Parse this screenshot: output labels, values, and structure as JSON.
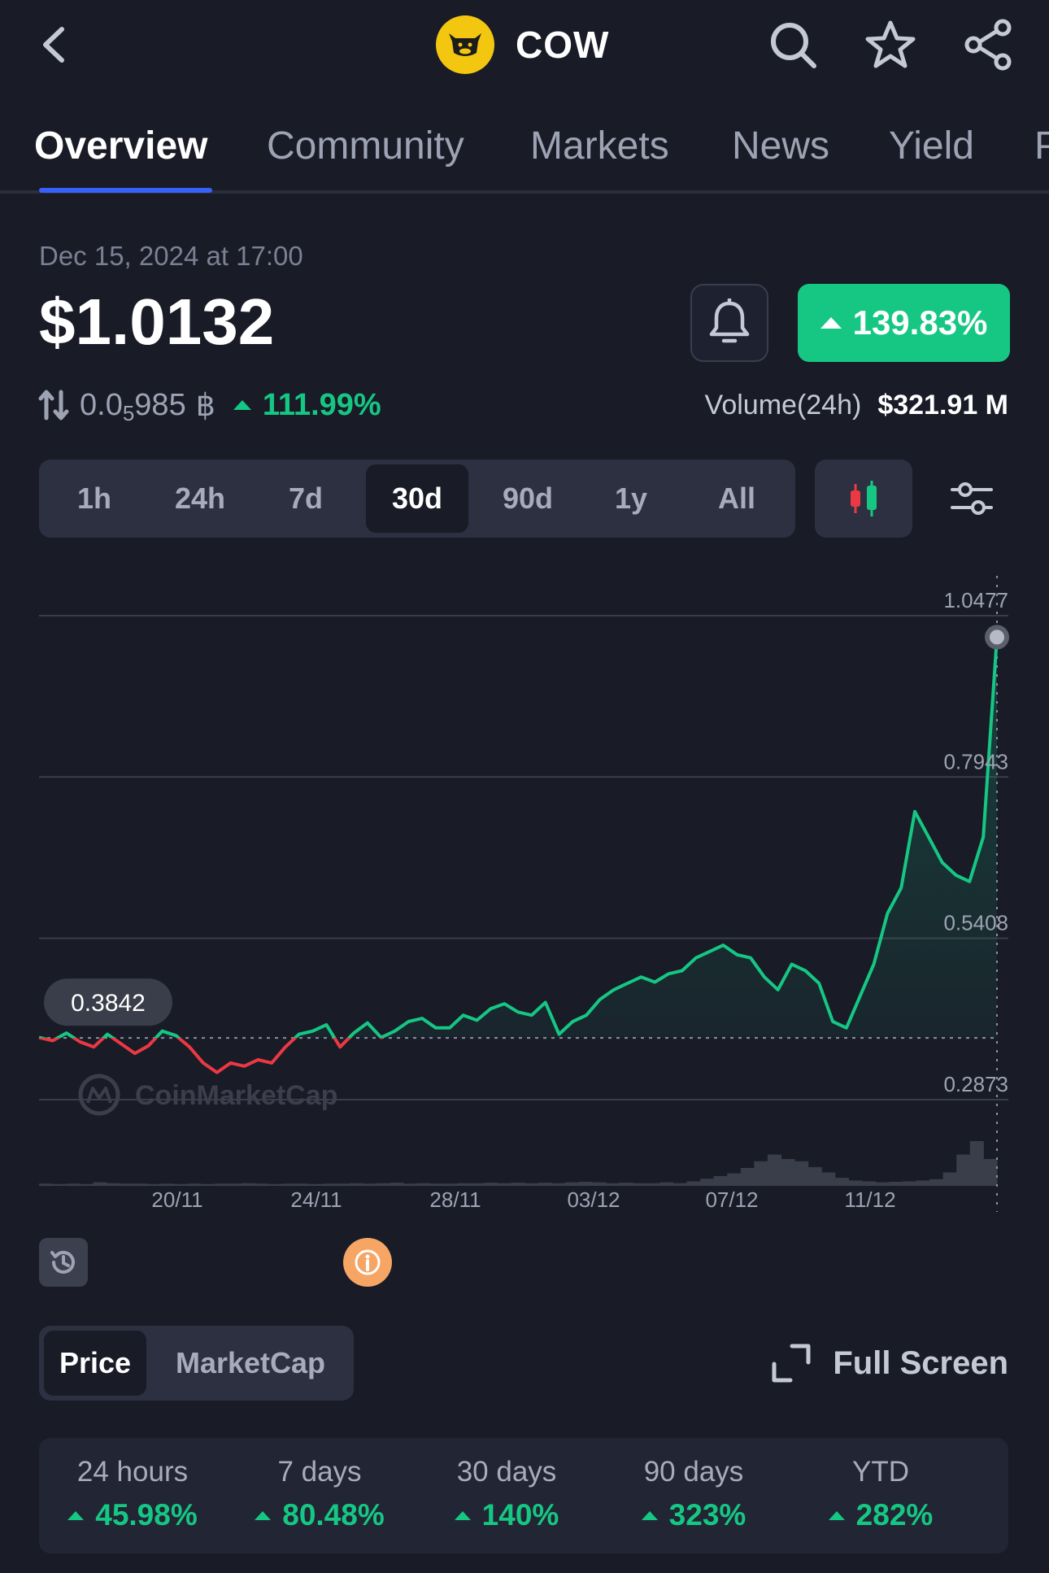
{
  "header": {
    "coin_name": "COW",
    "icons": [
      "back-chevron-icon",
      "search-icon",
      "star-icon",
      "share-icon"
    ]
  },
  "tabs": [
    {
      "label": "Overview",
      "active": true
    },
    {
      "label": "Community"
    },
    {
      "label": "Markets"
    },
    {
      "label": "News"
    },
    {
      "label": "Yield"
    },
    {
      "label": "P"
    }
  ],
  "price": {
    "timestamp": "Dec 15, 2024 at 17:00",
    "value": "$1.0132",
    "change_pct": "139.83%",
    "btc_prefix": "0.0",
    "btc_zeros": "5",
    "btc_digits": "985",
    "btc_symbol": "฿",
    "btc_change": "111.99%",
    "volume_label": "Volume(24h)",
    "volume_value": "$321.91 M"
  },
  "ranges": [
    "1h",
    "24h",
    "7d",
    "30d",
    "90d",
    "1y",
    "All"
  ],
  "active_range": "30d",
  "colors": {
    "up": "#16c784",
    "down": "#ea3943",
    "bg": "#191b27",
    "accent": "#3861fb"
  },
  "chart_data": {
    "type": "line",
    "y_ticks": [
      "1.0477",
      "0.7943",
      "0.5408",
      "0.2873"
    ],
    "ylim": [
      0.2873,
      1.0477
    ],
    "x_ticks": [
      "20/11",
      "24/11",
      "28/11",
      "03/12",
      "07/12",
      "11/12"
    ],
    "baseline_label": "0.3842",
    "baseline": 0.3842,
    "watermark": "CoinMarketCap",
    "series": [
      {
        "x": [
          0,
          1,
          2,
          3,
          4,
          5,
          6,
          7,
          8,
          9,
          10,
          11,
          12,
          13,
          14,
          15,
          16,
          17,
          18,
          19,
          20,
          21,
          22,
          23,
          24,
          25,
          26,
          27,
          28,
          29,
          30,
          31,
          32,
          33,
          34,
          35,
          36,
          37,
          38,
          39,
          40,
          41,
          42,
          43,
          44,
          45,
          46,
          47,
          48,
          49,
          50,
          51,
          52,
          53,
          54,
          55,
          56,
          57,
          58,
          59,
          60,
          61,
          62,
          63,
          64,
          65,
          66,
          67,
          68,
          69,
          70
        ],
        "y": [
          0.385,
          0.38,
          0.392,
          0.378,
          0.37,
          0.39,
          0.375,
          0.36,
          0.372,
          0.395,
          0.388,
          0.37,
          0.345,
          0.33,
          0.345,
          0.34,
          0.35,
          0.345,
          0.37,
          0.39,
          0.395,
          0.405,
          0.37,
          0.392,
          0.408,
          0.385,
          0.395,
          0.41,
          0.415,
          0.4,
          0.4,
          0.42,
          0.412,
          0.43,
          0.438,
          0.425,
          0.42,
          0.44,
          0.39,
          0.41,
          0.42,
          0.445,
          0.46,
          0.47,
          0.48,
          0.472,
          0.485,
          0.49,
          0.51,
          0.52,
          0.53,
          0.515,
          0.51,
          0.48,
          0.46,
          0.5,
          0.49,
          0.47,
          0.41,
          0.4,
          0.45,
          0.5,
          0.58,
          0.62,
          0.74,
          0.7,
          0.66,
          0.64,
          0.63,
          0.7,
          1.014
        ]
      }
    ],
    "volume_bars": [
      0.05,
      0.04,
      0.05,
      0.04,
      0.08,
      0.06,
      0.05,
      0.05,
      0.04,
      0.05,
      0.04,
      0.05,
      0.04,
      0.05,
      0.05,
      0.06,
      0.05,
      0.04,
      0.05,
      0.05,
      0.04,
      0.05,
      0.05,
      0.06,
      0.05,
      0.06,
      0.07,
      0.05,
      0.06,
      0.05,
      0.05,
      0.06,
      0.06,
      0.07,
      0.06,
      0.07,
      0.06,
      0.07,
      0.06,
      0.08,
      0.09,
      0.08,
      0.06,
      0.07,
      0.06,
      0.06,
      0.08,
      0.06,
      0.1,
      0.16,
      0.22,
      0.28,
      0.4,
      0.55,
      0.7,
      0.6,
      0.55,
      0.42,
      0.3,
      0.18,
      0.12,
      0.1,
      0.08,
      0.09,
      0.1,
      0.12,
      0.15,
      0.3,
      0.7,
      1.0,
      0.6
    ]
  },
  "toggle": {
    "price": "Price",
    "marketcap": "MarketCap"
  },
  "fullscreen_label": "Full Screen",
  "performance": [
    {
      "label": "24 hours",
      "value": "45.98%"
    },
    {
      "label": "7 days",
      "value": "80.48%"
    },
    {
      "label": "30 days",
      "value": "140%"
    },
    {
      "label": "90 days",
      "value": "323%"
    },
    {
      "label": "YTD",
      "value": "282%"
    }
  ]
}
